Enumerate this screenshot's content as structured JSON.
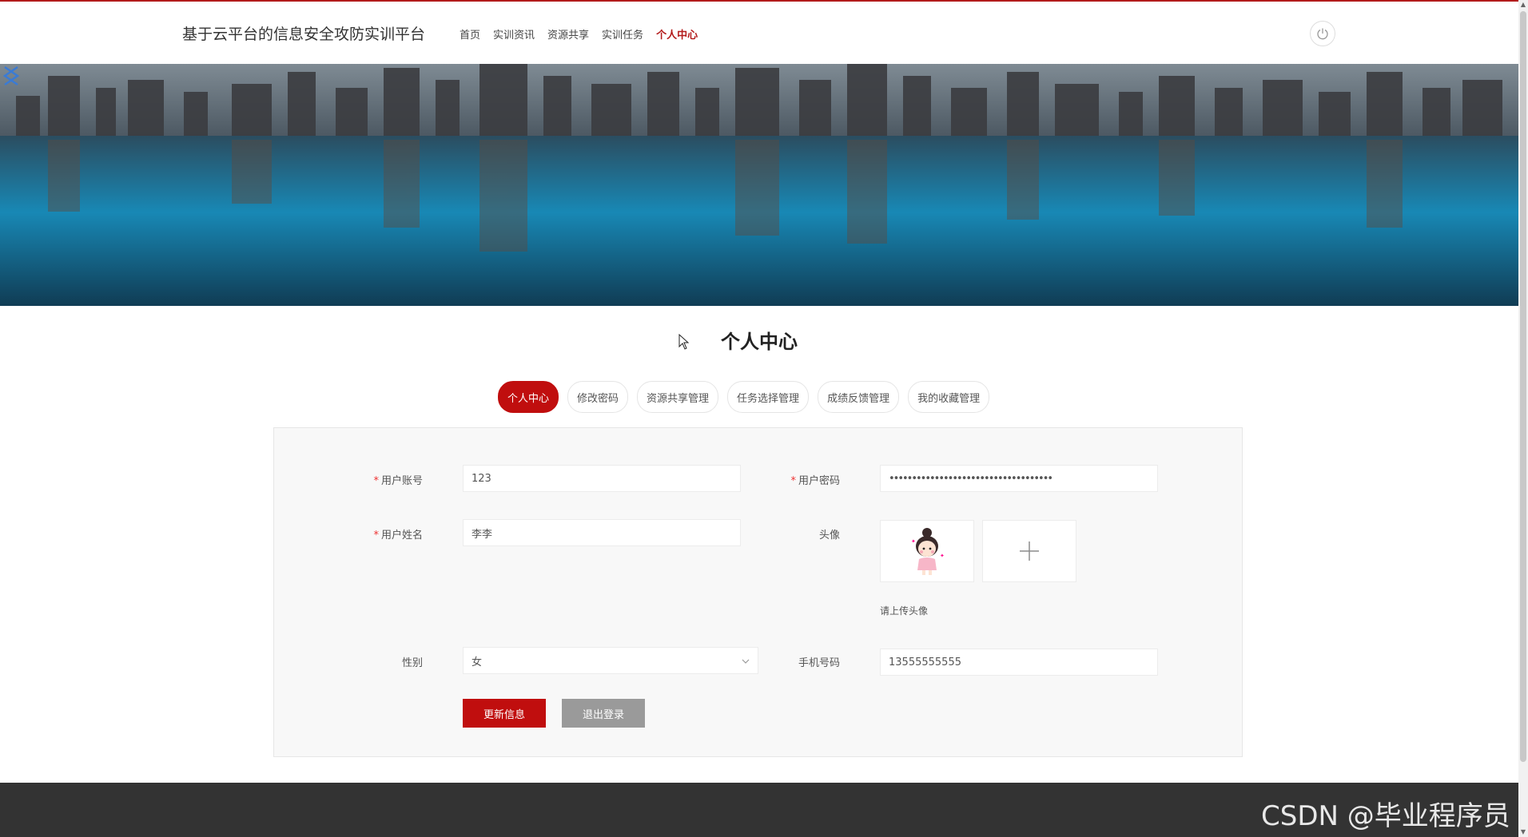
{
  "header": {
    "site_title": "基于云平台的信息安全攻防实训平台",
    "nav": [
      {
        "label": "首页",
        "active": false
      },
      {
        "label": "实训资讯",
        "active": false
      },
      {
        "label": "资源共享",
        "active": false
      },
      {
        "label": "实训任务",
        "active": false
      },
      {
        "label": "个人中心",
        "active": true
      }
    ],
    "power_icon": "power-icon"
  },
  "banner": {
    "image": "city-skyline-reflection",
    "prev_icon": "chevron-left-icon",
    "next_icon": "chevron-right-icon"
  },
  "page": {
    "title": "个人中心"
  },
  "tabs": [
    {
      "label": "个人中心",
      "active": true
    },
    {
      "label": "修改密码",
      "active": false
    },
    {
      "label": "资源共享管理",
      "active": false
    },
    {
      "label": "任务选择管理",
      "active": false
    },
    {
      "label": "成绩反馈管理",
      "active": false
    },
    {
      "label": "我的收藏管理",
      "active": false
    }
  ],
  "form": {
    "account": {
      "label": "用户账号",
      "value": "123",
      "required": true
    },
    "password": {
      "label": "用户密码",
      "value": "••••••••••••••••••••••••••••••••••••",
      "required": true
    },
    "name": {
      "label": "用户姓名",
      "value": "李李",
      "required": true
    },
    "avatar": {
      "label": "头像",
      "hint": "请上传头像",
      "add_icon": "plus-icon"
    },
    "gender": {
      "label": "性别",
      "value": "女"
    },
    "phone": {
      "label": "手机号码",
      "value": "13555555555"
    },
    "update_button": "更新信息",
    "logout_button": "退出登录"
  },
  "colors": {
    "accent": "#c00e0e",
    "logout": "#9a9a9a",
    "footer": "#333333"
  },
  "watermark": "CSDN @毕业程序员"
}
